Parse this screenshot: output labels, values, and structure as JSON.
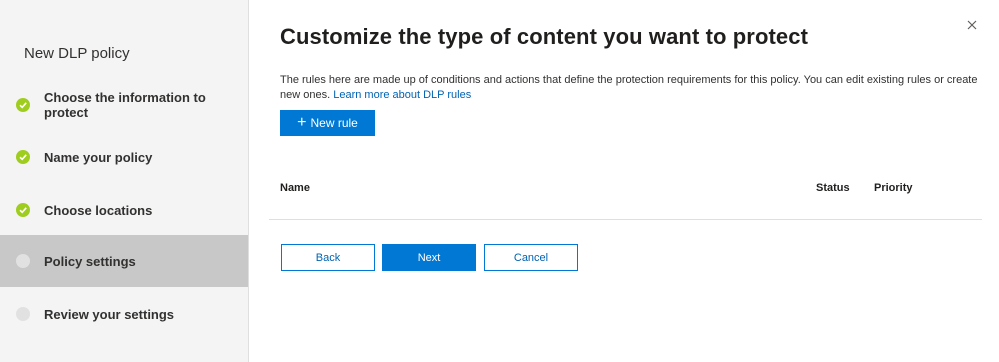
{
  "sidebar": {
    "title": "New DLP policy",
    "steps": [
      {
        "label": "Choose the information to protect",
        "state": "done"
      },
      {
        "label": "Name your policy",
        "state": "done"
      },
      {
        "label": "Choose locations",
        "state": "done"
      },
      {
        "label": "Policy settings",
        "state": "active"
      },
      {
        "label": "Review your settings",
        "state": "pending"
      }
    ]
  },
  "main": {
    "close_icon": "close-icon",
    "heading": "Customize the type of content you want to protect",
    "description": "The rules here are made up of conditions and actions that define the protection requirements for this policy. You can edit existing rules or create new ones.",
    "learn_more_link": "Learn more about DLP rules",
    "new_rule_label": "New rule",
    "table": {
      "columns": [
        "Name",
        "Status",
        "Priority"
      ]
    },
    "buttons": {
      "back": "Back",
      "next": "Next",
      "cancel": "Cancel"
    }
  },
  "colors": {
    "accent": "#0078d4",
    "link": "#0063b1",
    "complete": "#9fcd1f",
    "pending": "#e1e1e1",
    "active_step_bg": "#c8c8c8",
    "sidebar_bg": "#f4f4f4"
  }
}
